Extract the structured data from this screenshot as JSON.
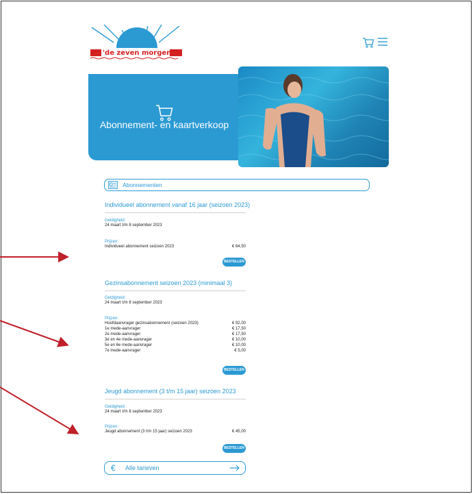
{
  "logo": {
    "text": "'de zeven morgen'"
  },
  "header": {
    "cart_icon": "cart-icon",
    "menu_icon": "menu-icon"
  },
  "hero": {
    "title": "Abonnement- en kaartverkoop",
    "icon": "cart-icon"
  },
  "section": {
    "label": "Abonnementen",
    "icon": "id-card-icon"
  },
  "validity_label": "Geldigheid:",
  "prices_label": "Prijzen:",
  "order_label": "BESTELLEN",
  "subscriptions": [
    {
      "title": "Individueel abonnement vanaf 16 jaar (seizoen 2023)",
      "validity": "24 maart t/m 8 september 2023",
      "prices": [
        {
          "name": "Individueel abonnement seizoen 2023",
          "amount": "€ 64,50"
        }
      ]
    },
    {
      "title": "Gezinsabonnement seizoen 2023 (minimaal 3)",
      "validity": "24 maart t/m 8 september 2023",
      "prices": [
        {
          "name": "Hoofdaanvrager gezinsabonnement (seizoen 2023)",
          "amount": "€ 92,00"
        },
        {
          "name": "1e mede-aanvrager",
          "amount": "€ 17,50"
        },
        {
          "name": "2e mede-aanvrager",
          "amount": "€ 17,50"
        },
        {
          "name": "3e en 4e mede-aanvrager",
          "amount": "€ 10,00"
        },
        {
          "name": "5e en 6e mede-aanvrager",
          "amount": "€ 10,00"
        },
        {
          "name": "7e mede-aanvrager",
          "amount": "€ 5,00"
        }
      ]
    },
    {
      "title": "Jeugd abonnement (3 t/m 15 jaar) seizoen 2023",
      "validity": "24 maart t/m 8 september 2023",
      "prices": [
        {
          "name": "Jeugd abonnement (3 t/m 15 jaar) seizoen 2023",
          "amount": "€ 45,00"
        }
      ]
    }
  ],
  "back": {
    "label": "Alle tarieven",
    "euro": "€",
    "arrow_icon": "arrow-right-icon"
  },
  "colors": {
    "accent": "#2b9ad3",
    "logo_red": "#d42020",
    "annotation_arrow": "#c0202a"
  }
}
